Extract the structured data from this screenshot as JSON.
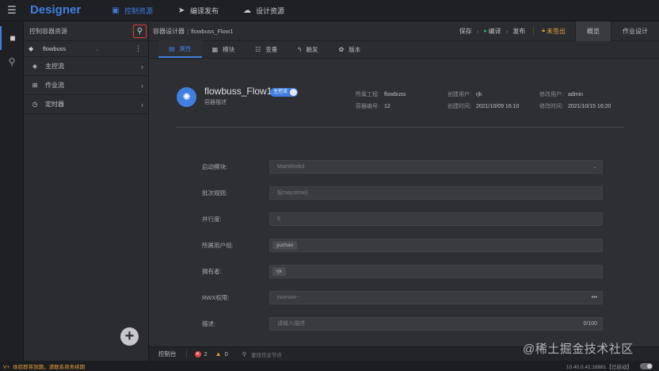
{
  "app": {
    "brand": "Designer",
    "nav": [
      {
        "icon": "control-resources-icon",
        "label": "控制资源",
        "active": true
      },
      {
        "icon": "send-icon",
        "label": "编译发布",
        "active": false
      },
      {
        "icon": "cloud-icon",
        "label": "设计资源",
        "active": false
      }
    ]
  },
  "left_panel": {
    "title": "控制容器资源",
    "selected": "flowbuss",
    "items": [
      {
        "icon": "main-flow-icon",
        "label": "主控流"
      },
      {
        "icon": "job-flow-icon",
        "label": "作业流"
      },
      {
        "icon": "timer-icon",
        "label": "定时器"
      }
    ]
  },
  "breadcrumb": {
    "root": "容器设计器",
    "leaf": "flowbuss_Flow1"
  },
  "toolbar": {
    "save": "保存",
    "compile": "编译",
    "publish": "发布",
    "status": "未签出",
    "tab_overview": "概览",
    "tab_job_design": "作业设计"
  },
  "subtabs": [
    {
      "icon": "attributes-icon",
      "label": "属性"
    },
    {
      "icon": "module-icon",
      "label": "模块"
    },
    {
      "icon": "variable-icon",
      "label": "变量"
    },
    {
      "icon": "trigger-icon",
      "label": "触发"
    },
    {
      "icon": "version-icon",
      "label": "版本"
    }
  ],
  "flow": {
    "name": "flowbuss_Flow1",
    "badge": "主控流",
    "description": "容器描述",
    "project_label": "所属工程:",
    "project": "flowbuss",
    "container_no_label": "容器编号:",
    "container_no": "12",
    "creator_label": "创建用户:",
    "creator": "rjk",
    "created_label": "创建时间:",
    "created": "2021/10/09 16:10",
    "modifier_label": "修改用户:",
    "modifier": "admin",
    "modified_label": "修改时间:",
    "modified": "2021/10/15 16:20"
  },
  "form": {
    "start_module_label": "启动模块:",
    "start_module_value": "MainModul",
    "batch_rule_label": "批次规则:",
    "batch_rule_value": "${maystime}",
    "concurrency_label": "并行度:",
    "concurrency_value": "5",
    "user_group_label": "所属用户组:",
    "user_group_value": "yuchao",
    "owner_label": "拥有者:",
    "owner_value": "rjk",
    "rwx_label": "RWX权限:",
    "rwx_value": "rwxrwxr--",
    "rwx_suffix": "•••",
    "desc_label": "描述:",
    "desc_placeholder": "请输入描述",
    "desc_counter": "0/100"
  },
  "console": {
    "title": "控制台",
    "errors": "2",
    "warnings": "0",
    "search_placeholder": "查找作业节点"
  },
  "statusbar": {
    "version_prefix": "V+",
    "notice": "体验即将到期，请联系商务续期",
    "server": "10.40.0.41:16881【已启动】"
  },
  "watermark": "@稀土掘金技术社区"
}
